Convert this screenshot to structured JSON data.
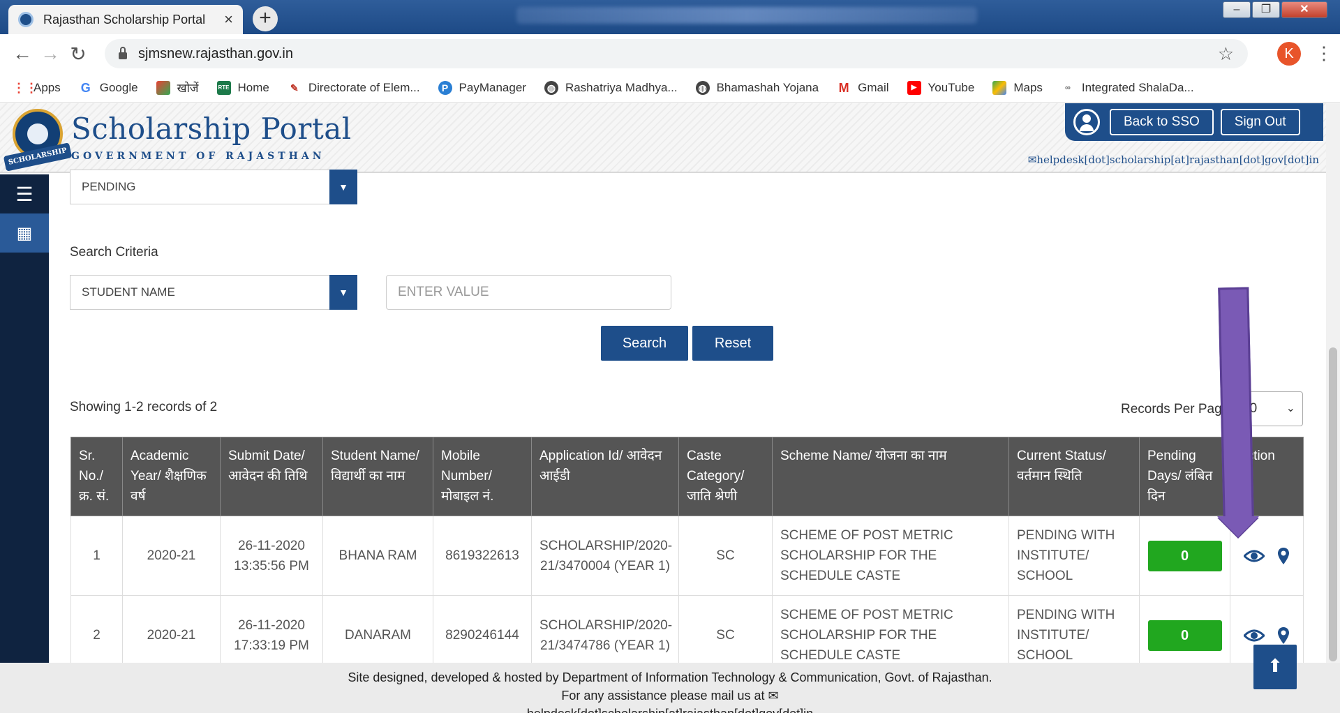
{
  "browser": {
    "tab_title": "Rajasthan Scholarship Portal",
    "tab_close": "×",
    "new_tab": "+",
    "url": "sjmsnew.rajasthan.gov.in",
    "profile_initial": "K",
    "bookmarks": [
      {
        "label": "Apps",
        "icon": "apps-grid-icon"
      },
      {
        "label": "Google",
        "icon": "google-icon"
      },
      {
        "label": "खोजें",
        "icon": "khojen-icon"
      },
      {
        "label": "Home",
        "icon": "rte-home-icon"
      },
      {
        "label": "Directorate of Elem...",
        "icon": "directorate-icon"
      },
      {
        "label": "PayManager",
        "icon": "paymanager-icon"
      },
      {
        "label": "Rashatriya Madhya...",
        "icon": "globe-icon"
      },
      {
        "label": "Bhamashah Yojana",
        "icon": "globe-icon"
      },
      {
        "label": "Gmail",
        "icon": "gmail-icon"
      },
      {
        "label": "YouTube",
        "icon": "youtube-icon"
      },
      {
        "label": "Maps",
        "icon": "maps-icon"
      },
      {
        "label": "Integrated ShalaDa...",
        "icon": "shaladarpan-icon"
      }
    ]
  },
  "header": {
    "title": "Scholarship Portal",
    "subtitle": "GOVERNMENT OF RAJASTHAN",
    "logo_ribbon": "SCHOLARSHIP",
    "back_to_sso": "Back to SSO",
    "sign_out": "Sign Out",
    "helpdesk": "helpdesk[dot]scholarship[at]rajasthan[dot]gov[dot]in"
  },
  "filters": {
    "status_value": "PENDING",
    "search_criteria_label": "Search Criteria",
    "criteria_value": "STUDENT NAME",
    "value_placeholder": "ENTER VALUE",
    "search_label": "Search",
    "reset_label": "Reset"
  },
  "results": {
    "showing_text": "Showing 1-2 records of 2",
    "records_per_page_label": "Records Per Page",
    "records_per_page_value": "10",
    "columns": [
      "Sr. No./ क्र. सं.",
      "Academic Year/ शैक्षणिक वर्ष",
      "Submit Date/ आवेदन की तिथि",
      "Student Name/ विद्यार्थी का नाम",
      "Mobile Number/ मोबाइल नं.",
      "Application Id/ आवेदन आईडी",
      "Caste Category/ जाति श्रेणी",
      "Scheme Name/ योजना का नाम",
      "Current Status/ वर्तमान स्थिति",
      "Pending Days/ लंबित दिन",
      "Action"
    ],
    "rows": [
      {
        "sr": "1",
        "year": "2020-21",
        "date": "26-11-2020 13:35:56 PM",
        "name": "BHANA RAM",
        "mobile": "8619322613",
        "app_id": "SCHOLARSHIP/2020-21/3470004 (YEAR 1)",
        "caste": "SC",
        "scheme": "SCHEME OF POST METRIC SCHOLARSHIP FOR THE SCHEDULE CASTE",
        "status": "PENDING WITH INSTITUTE/ SCHOOL",
        "pending_days": "0"
      },
      {
        "sr": "2",
        "year": "2020-21",
        "date": "26-11-2020 17:33:19 PM",
        "name": "DANARAM",
        "mobile": "8290246144",
        "app_id": "SCHOLARSHIP/2020-21/3474786 (YEAR 1)",
        "caste": "SC",
        "scheme": "SCHEME OF POST METRIC SCHOLARSHIP FOR THE SCHEDULE CASTE",
        "status": "PENDING WITH INSTITUTE/ SCHOOL",
        "pending_days": "0"
      }
    ]
  },
  "footer": {
    "line1": "Site designed, developed & hosted by Department of Information Technology & Communication, Govt. of Rajasthan.",
    "line2": "For any assistance please mail us at",
    "line3": "helpdesk[dot]scholarship[at]rajasthan[dot]gov[dot]in"
  },
  "colors": {
    "brand_blue": "#1e4e8a",
    "sidebar_dark": "#0f2340",
    "table_header": "#555555",
    "badge_green": "#21a71f",
    "annotation_purple": "#7a5ab5"
  }
}
